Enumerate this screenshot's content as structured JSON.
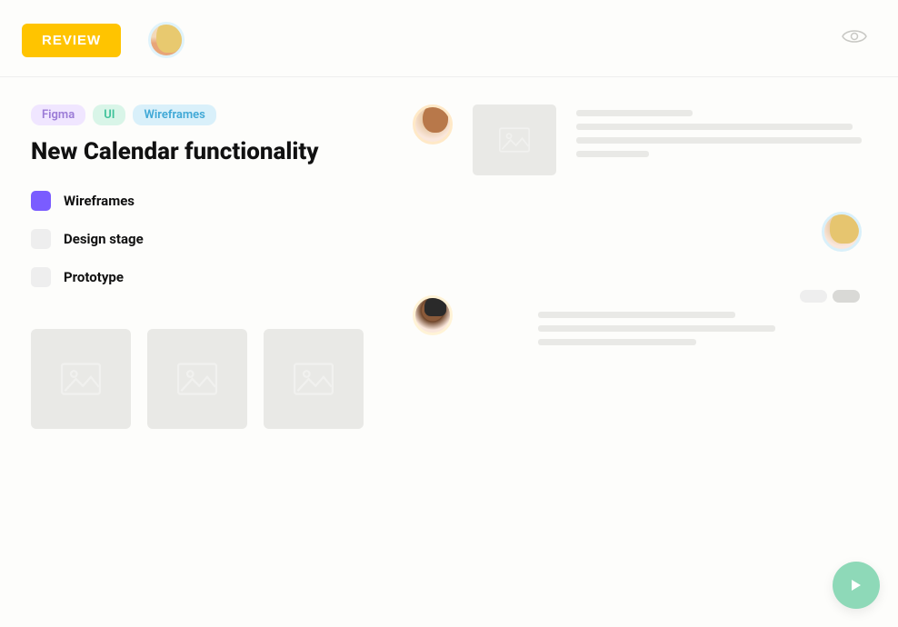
{
  "header": {
    "review_label": "REVIEW"
  },
  "tags": [
    {
      "label": "Figma",
      "cls": "tag-figma"
    },
    {
      "label": "UI",
      "cls": "tag-ui"
    },
    {
      "label": "Wireframes",
      "cls": "tag-wireframes"
    }
  ],
  "title": "New Calendar functionality",
  "stages": [
    {
      "label": "Wireframes",
      "active": true
    },
    {
      "label": "Design stage",
      "active": false
    },
    {
      "label": "Prototype",
      "active": false
    }
  ]
}
